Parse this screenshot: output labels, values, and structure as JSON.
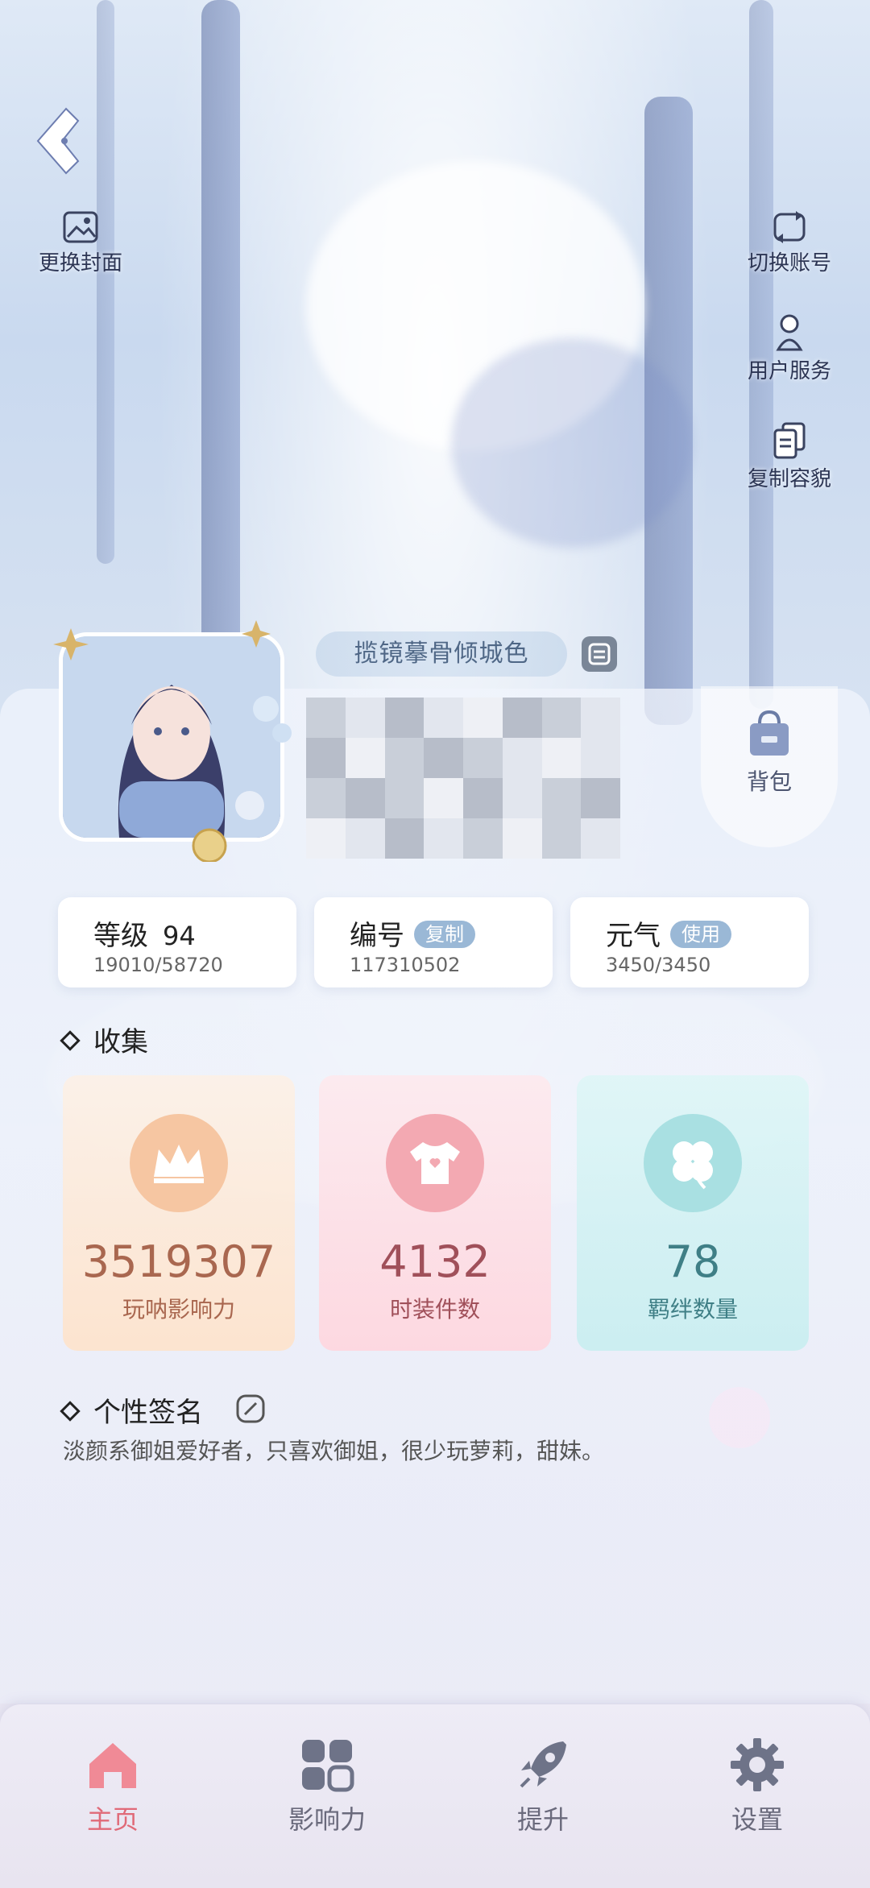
{
  "top_actions": {
    "change_cover": "更换封面",
    "switch_account": "切换账号",
    "user_service": "用户服务",
    "copy_appearance": "复制容貌"
  },
  "profile": {
    "nickname": "揽镜摹骨倾城色",
    "bag_label": "背包"
  },
  "stats": {
    "level": {
      "label": "等级",
      "value": "94",
      "sub": "19010/58720"
    },
    "id": {
      "label": "编号",
      "action": "复制",
      "sub": "117310502"
    },
    "energy": {
      "label": "元气",
      "action": "使用",
      "sub": "3450/3450"
    }
  },
  "collection": {
    "title": "收集",
    "cards": [
      {
        "value": "3519307",
        "label": "玩呐影响力",
        "icon": "crown-icon",
        "color": "#a9674f"
      },
      {
        "value": "4132",
        "label": "时装件数",
        "icon": "tshirt-icon",
        "color": "#a0505a"
      },
      {
        "value": "78",
        "label": "羁绊数量",
        "icon": "clover-icon",
        "color": "#3f7f86"
      }
    ]
  },
  "signature": {
    "title": "个性签名",
    "text": "淡颜系御姐爱好者，只喜欢御姐，很少玩萝莉，甜妹。"
  },
  "nav": {
    "items": [
      {
        "label": "主页",
        "icon": "home-icon",
        "active": true
      },
      {
        "label": "影响力",
        "icon": "grid-icon",
        "active": false
      },
      {
        "label": "提升",
        "icon": "rocket-icon",
        "active": false
      },
      {
        "label": "设置",
        "icon": "gear-icon",
        "active": false
      }
    ]
  },
  "colors": {
    "accent": "#e06a78",
    "pill": "#9ab8d6"
  }
}
